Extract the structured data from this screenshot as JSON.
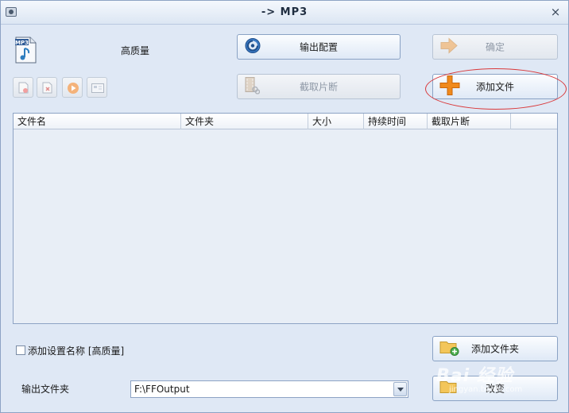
{
  "window": {
    "title": "-> MP3"
  },
  "preset": {
    "label": "高质量",
    "format_badge": "MP3"
  },
  "buttons": {
    "output_config": "输出配置",
    "ok": "确定",
    "cut_clip": "截取片断",
    "add_file": "添加文件",
    "add_folder": "添加文件夹",
    "change": "改变"
  },
  "file_list": {
    "columns": [
      "文件名",
      "文件夹",
      "大小",
      "持续时间",
      "截取片断"
    ]
  },
  "options": {
    "append_setting_name": "添加设置名称 [高质量]",
    "append_setting_checked": false
  },
  "output": {
    "label": "输出文件夹",
    "path": "F:\\FFOutput"
  },
  "watermark": {
    "main": "Bai 经验",
    "sub": "jingyan.baidu.com"
  },
  "colors": {
    "accent_orange": "#f08a1c",
    "highlight_red": "#d9383a",
    "window_bg": "#dfe8f5"
  }
}
